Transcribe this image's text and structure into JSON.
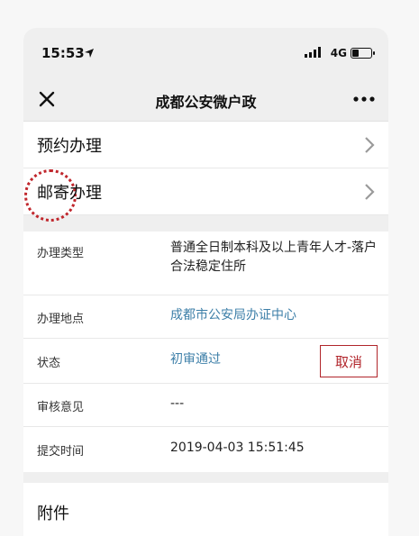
{
  "statusbar": {
    "time": "15:53",
    "network": "4G",
    "battery_level": 0.35
  },
  "navbar": {
    "title": "成都公安微户政"
  },
  "menu": [
    {
      "label": "预约办理"
    },
    {
      "label": "邮寄办理"
    }
  ],
  "details": {
    "type_label": "办理类型",
    "type_value": "普通全日制本科及以上青年人才-落户合法稳定住所",
    "location_label": "办理地点",
    "location_value": "成都市公安局办证中心",
    "status_label": "状态",
    "status_value": "初审通过",
    "cancel_label": "取消",
    "review_label": "审核意见",
    "review_value": "---",
    "submit_label": "提交时间",
    "submit_value": "2019-04-03 15:51:45"
  },
  "attachments": {
    "label": "附件"
  },
  "colors": {
    "accent_red": "#b1252b",
    "link_blue": "#3d7fa8",
    "bar_gray": "#efefef"
  }
}
